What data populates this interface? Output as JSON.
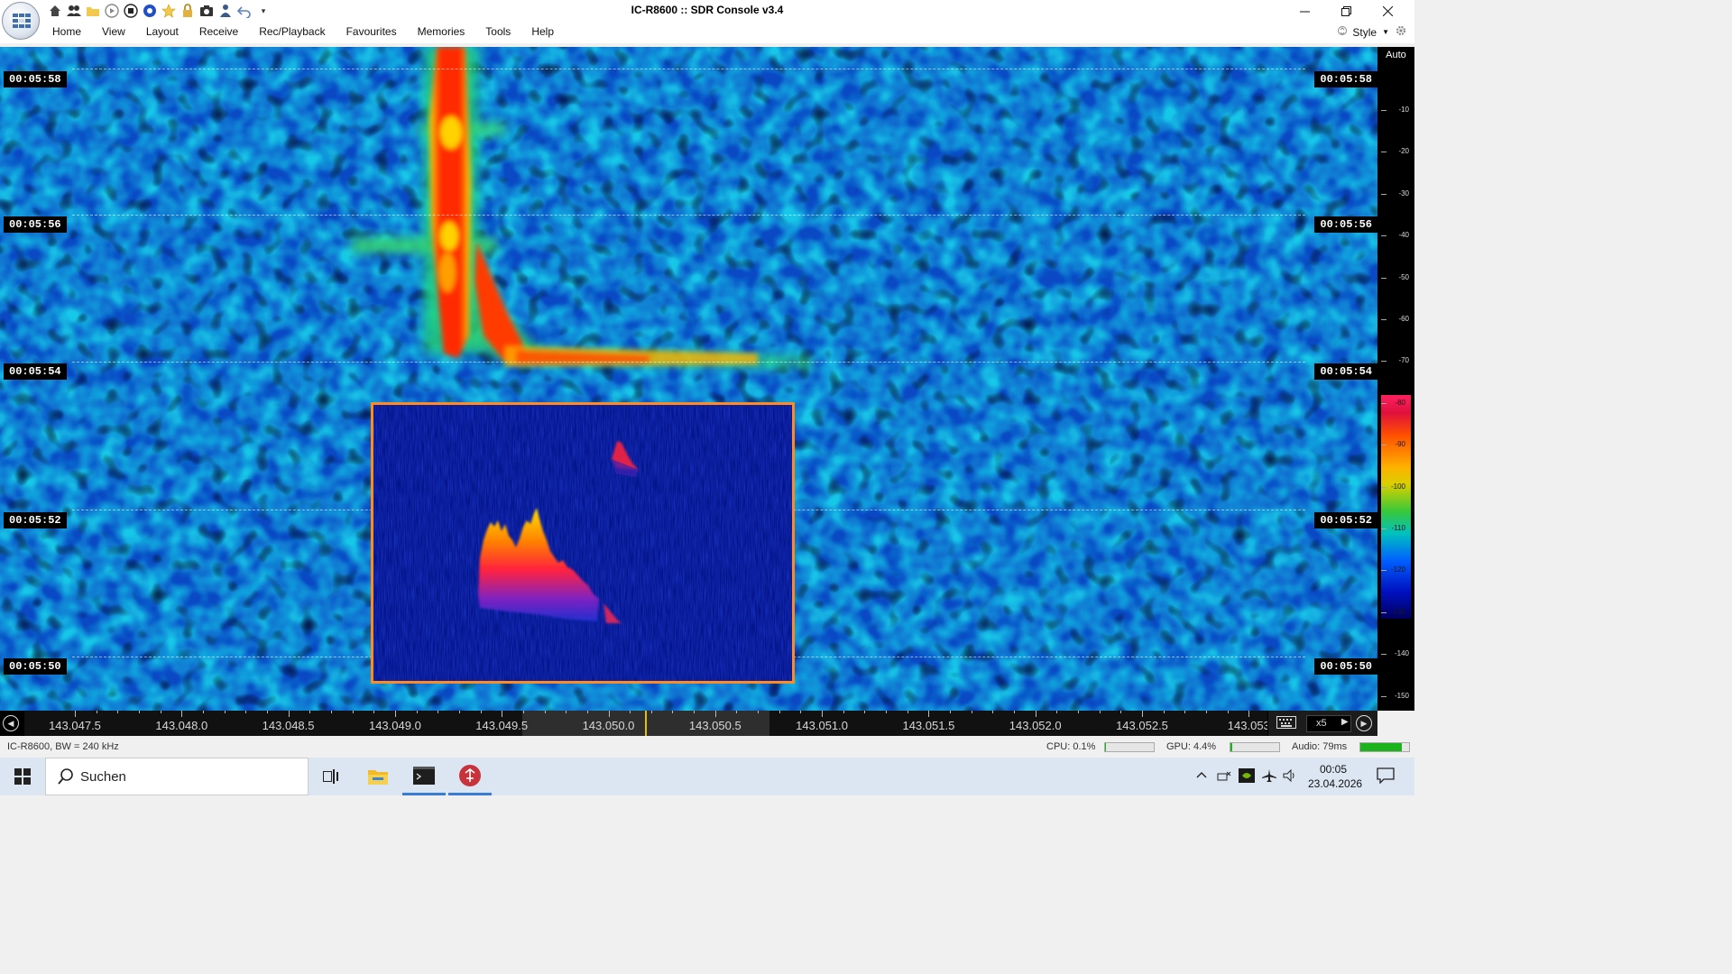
{
  "window": {
    "title": "IC-R8600 :: SDR Console v3.4",
    "minimize_icon": "minimize-icon",
    "restore_icon": "restore-icon",
    "close_icon": "close-icon"
  },
  "quick_access": {
    "icons": [
      "home-icon",
      "users-icon",
      "folder-icon",
      "play-icon",
      "stop-icon",
      "record-icon",
      "favourite-star-icon",
      "lock-icon",
      "camera-icon",
      "person-icon",
      "undo-icon",
      "dropdown-icon"
    ]
  },
  "menu": {
    "items": [
      "Home",
      "View",
      "Layout",
      "Receive",
      "Rec/Playback",
      "Favourites",
      "Memories",
      "Tools",
      "Help"
    ],
    "style_label": "Style"
  },
  "waterfall": {
    "time_labels": [
      "00:05:58",
      "00:05:56",
      "00:05:54",
      "00:05:52",
      "00:05:50"
    ]
  },
  "scale": {
    "mode": "Auto",
    "ticks": [
      "-10",
      "-20",
      "-30",
      "-40",
      "-50",
      "-60",
      "-70",
      "-80",
      "-90",
      "-100",
      "-110",
      "-120",
      "-130",
      "-140",
      "-150"
    ]
  },
  "frequency_axis": {
    "labels": [
      "143.047.5",
      "143.048.0",
      "143.048.5",
      "143.049.0",
      "143.049.5",
      "143.050.0",
      "143.050.5",
      "143.051.0",
      "143.051.5",
      "143.052.0",
      "143.052.5",
      "143.053"
    ],
    "zoom": "x5"
  },
  "status": {
    "device": "IC-R8600, BW = 240 kHz",
    "cpu": "CPU: 0.1%",
    "cpu_load": 0.01,
    "gpu": "GPU: 4.4%",
    "gpu_load": 0.044,
    "audio": "Audio: 79ms",
    "audio_level": 0.85
  },
  "taskbar": {
    "search_placeholder": "Suchen",
    "clock_time": "00:05",
    "clock_date": "23.04.2026"
  },
  "colors": {
    "inset_border": "#ff8a1f",
    "frequency_marker": "#e4c000",
    "meter_green": "#1db31d"
  }
}
